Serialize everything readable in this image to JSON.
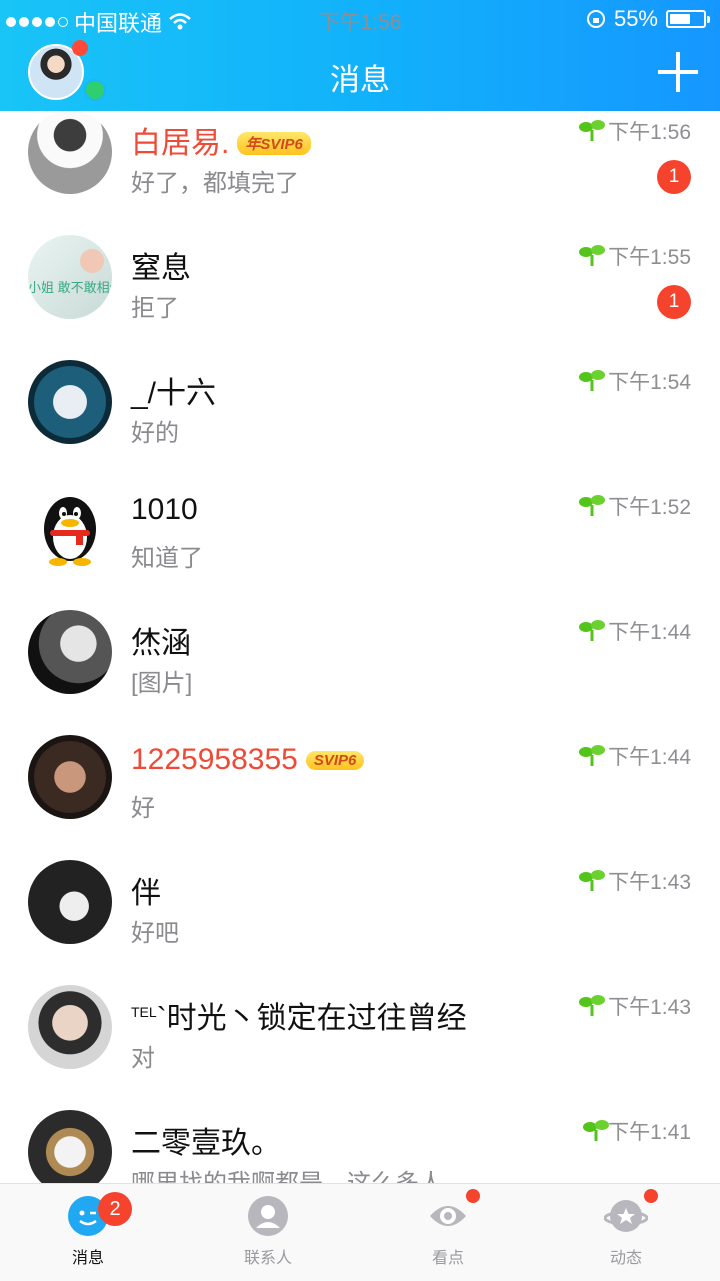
{
  "status_bar": {
    "carrier": "中国联通",
    "time": "下午1:56",
    "battery": "55%"
  },
  "header": {
    "title": "消息"
  },
  "conversations": [
    {
      "name": "白居易.",
      "vip_badge": "年SVIP6",
      "message": "好了，都填完了",
      "time": "下午1:56",
      "unread": "1"
    },
    {
      "name": "窒息",
      "message": "拒了",
      "time": "下午1:55",
      "unread": "1"
    },
    {
      "name": "_/十六",
      "message": "好的",
      "time": "下午1:54"
    },
    {
      "name": "1010",
      "message": "知道了",
      "time": "下午1:52"
    },
    {
      "name": "烋涵",
      "message": "[图片]",
      "time": "下午1:44"
    },
    {
      "name": "1225958355",
      "vip_badge": "SVIP6",
      "message": "好",
      "time": "下午1:44"
    },
    {
      "name": "伴",
      "message": "好吧",
      "time": "下午1:43"
    },
    {
      "name_prefix": "TEL",
      "name": "`时光丶锁定在过往曾经",
      "message": "对",
      "time": "下午1:43"
    },
    {
      "name": "二零壹玖。",
      "message": "哪里找的我啊都是，这么多人",
      "time": "下午1:41"
    }
  ],
  "avatar_text": "小姐 敢不敢相信我",
  "tabbar": {
    "tabs": [
      {
        "label": "消息",
        "badge": "2"
      },
      {
        "label": "联系人"
      },
      {
        "label": "看点"
      },
      {
        "label": "动态"
      }
    ]
  },
  "colors": {
    "header_start": "#19c4f7",
    "header_end": "#1597ff",
    "vip_name": "#ef4a36",
    "unread_badge": "#f6432e",
    "sprout": "#52c41a"
  }
}
